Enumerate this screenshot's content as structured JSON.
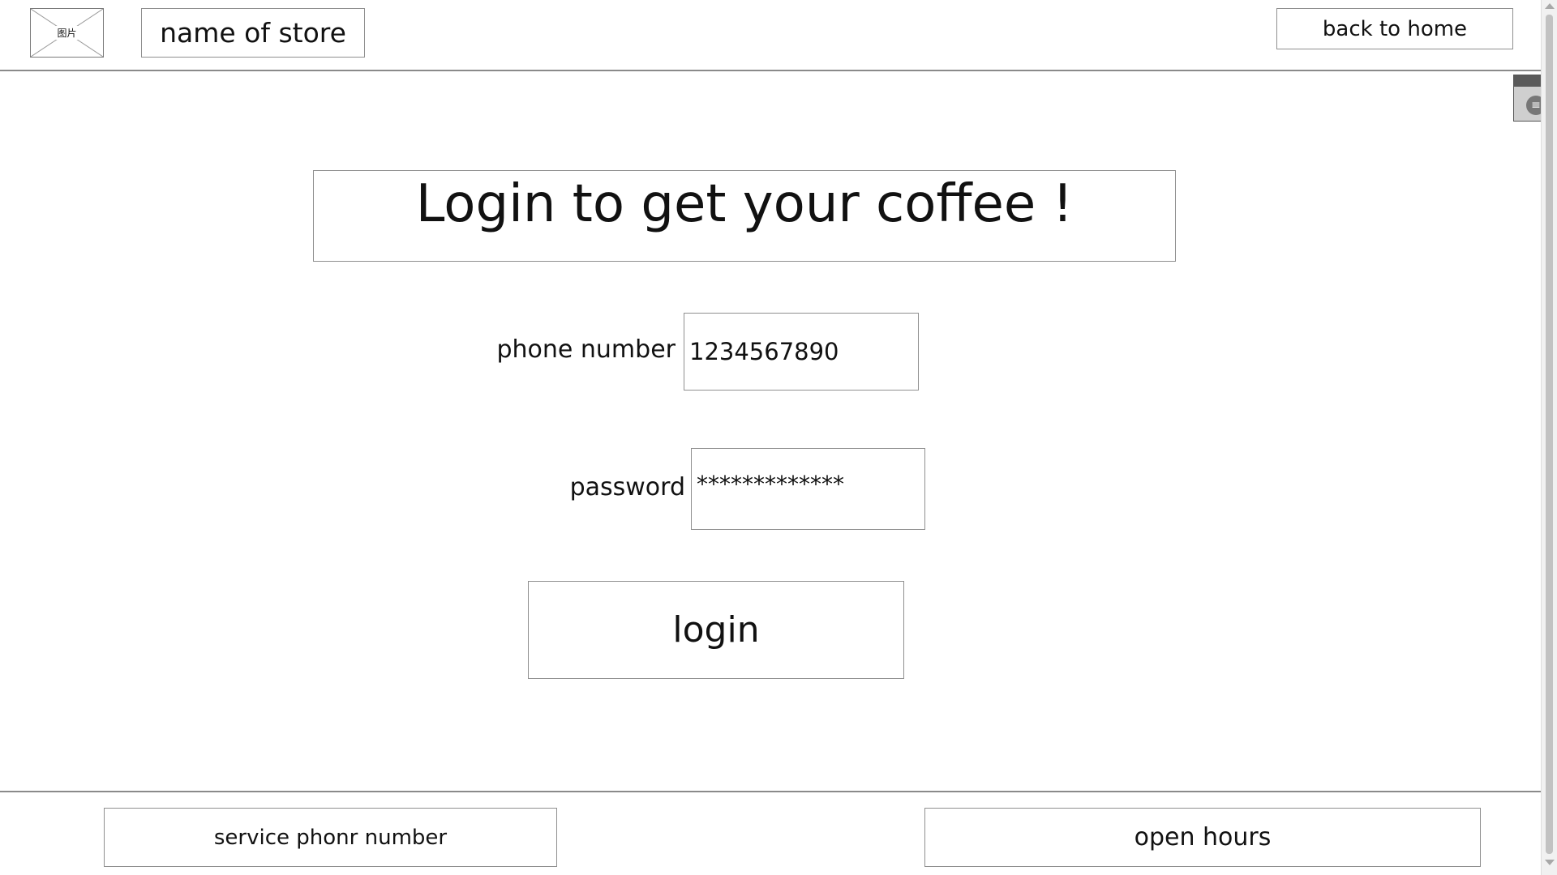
{
  "header": {
    "logo_text": "图片",
    "store_name": "name of store",
    "back_home_label": "back to home"
  },
  "main": {
    "title": "Login to get your coffee !",
    "phone_label": "phone number",
    "phone_value": "1234567890",
    "password_label": "password",
    "password_value": "*************",
    "login_label": "login"
  },
  "footer": {
    "service_label": "service phonr number",
    "hours_label": "open hours"
  },
  "widget": {
    "menu_glyph": "≡"
  }
}
